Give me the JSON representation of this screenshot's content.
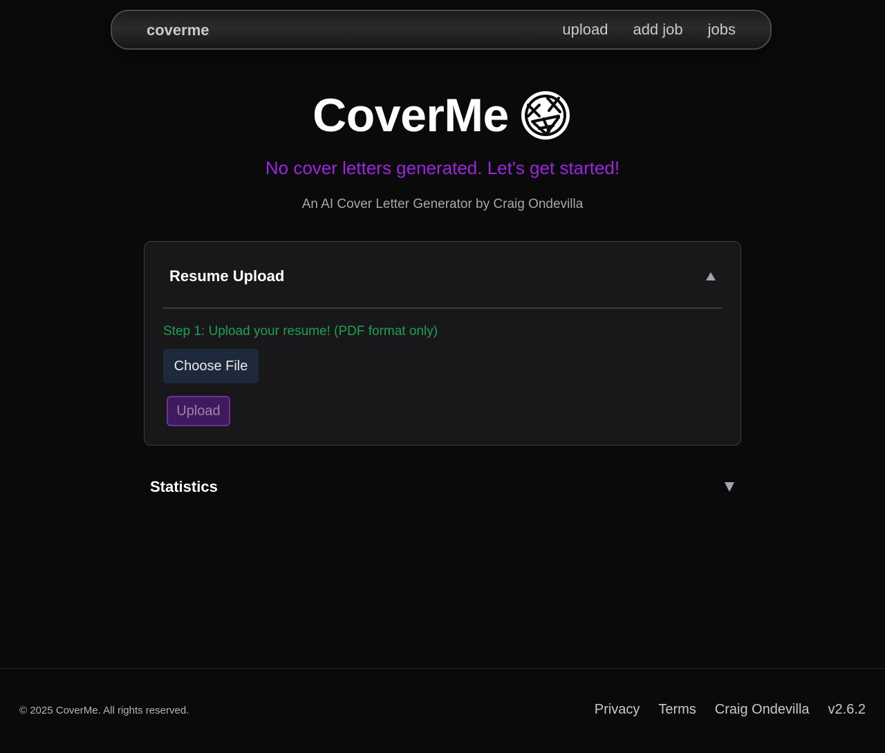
{
  "navbar": {
    "brand": "coverme",
    "links": [
      "upload",
      "add job",
      "jobs"
    ]
  },
  "hero": {
    "title": "CoverMe",
    "logo_icon": "scribble-face-icon",
    "status_message": "No cover letters generated. Let's get started!",
    "tagline": "An AI Cover Letter Generator by Craig Ondevilla"
  },
  "resume_upload": {
    "title": "Resume Upload",
    "step_label": "Step 1: Upload your resume! (PDF format only)",
    "choose_file_label": "Choose File",
    "upload_label": "Upload",
    "collapse_icon": "triangle-up-icon"
  },
  "statistics": {
    "title": "Statistics",
    "expand_icon": "triangle-down-icon"
  },
  "footer": {
    "copyright": "© 2025 CoverMe. All rights reserved.",
    "links": [
      "Privacy",
      "Terms",
      "Craig Ondevilla"
    ],
    "version": "v2.6.2"
  },
  "colors": {
    "background": "#0a0a0a",
    "status_purple": "#9b26e0",
    "step_green": "#1fa04f",
    "upload_button": "#3f1a5e",
    "choose_file_button": "#1e2a3b"
  }
}
